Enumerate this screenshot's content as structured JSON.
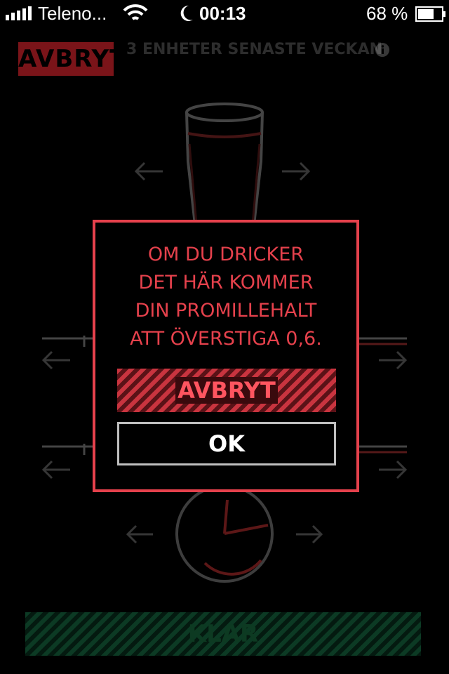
{
  "status_bar": {
    "carrier": "Teleno...",
    "time": "00:13",
    "battery": "68 %",
    "icons": [
      "signal-bars-icon",
      "wifi-icon",
      "moon-icon",
      "battery-icon"
    ]
  },
  "header": {
    "cancel_label": "AVBRYT",
    "units_label": "3 ENHETER SENASTE VECKAN",
    "info_icon": "info-icon"
  },
  "dialog": {
    "message_lines": [
      "OM DU DRICKER",
      "DET HÄR KOMMER",
      "DIN PROMILLEHALT",
      "ATT ÖVERSTIGA 0,6."
    ],
    "cancel_label": "AVBRYT",
    "ok_label": "OK"
  },
  "footer": {
    "done_label": "KLAR"
  },
  "colors": {
    "accent_red": "#e5414c",
    "done_green": "#0c3a24",
    "background": "#000000"
  }
}
